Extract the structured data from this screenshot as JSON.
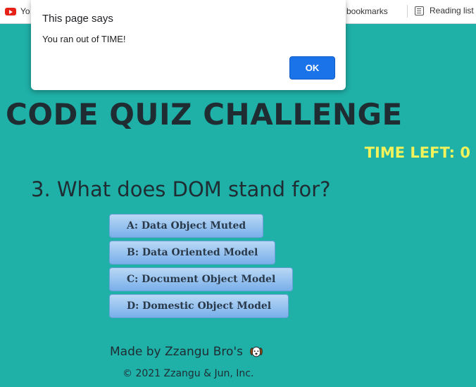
{
  "bookmarks": {
    "youtube_label": "Yo",
    "other_label": "er bookmarks",
    "reading_list_label": "Reading list"
  },
  "dialog": {
    "title": "This page says",
    "message": "You ran out of TIME!",
    "ok_label": "OK"
  },
  "page": {
    "title": "CODE QUIZ CHALLENGE",
    "timer": "TIME LEFT: 0",
    "question": "3. What does DOM stand for?",
    "answers": [
      "A: Data Object Muted",
      "B: Data Oriented Model",
      "C: Document Object Model",
      "D: Domestic Object Model"
    ]
  },
  "footer": {
    "credit": "Made by Zzangu Bro's",
    "copyright": "© 2021 Zzangu & Jun, Inc."
  },
  "colors": {
    "background": "#1fb0a7",
    "timer": "#f2f25a",
    "ok_button": "#1a73e8"
  }
}
